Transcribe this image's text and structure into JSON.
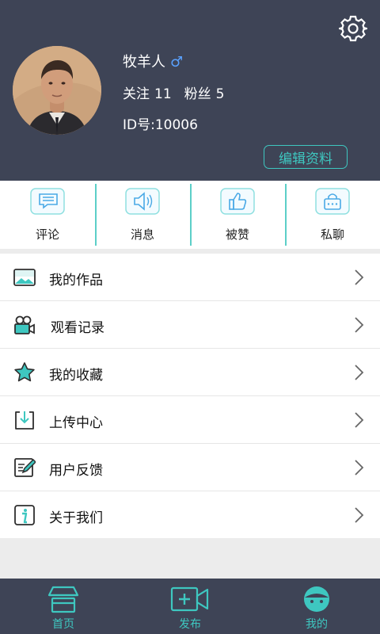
{
  "profile": {
    "name": "牧羊人",
    "gender_symbol": "♂",
    "follow_label": "关注",
    "follow_count": "11",
    "fans_label": "粉丝",
    "fans_count": "5",
    "id_label": "ID号:",
    "id_value": "10006",
    "edit_label": "编辑资料"
  },
  "quick_actions": [
    {
      "label": "评论",
      "icon": "comment-icon"
    },
    {
      "label": "消息",
      "icon": "speaker-icon"
    },
    {
      "label": "被赞",
      "icon": "thumbs-up-icon"
    },
    {
      "label": "私聊",
      "icon": "lock-chat-icon"
    }
  ],
  "menu": [
    {
      "label": "我的作品",
      "icon": "image-icon"
    },
    {
      "label": "观看记录",
      "icon": "video-camera-icon"
    },
    {
      "label": "我的收藏",
      "icon": "star-icon"
    },
    {
      "label": "上传中心",
      "icon": "download-tray-icon"
    },
    {
      "label": "用户反馈",
      "icon": "edit-note-icon"
    },
    {
      "label": "关于我们",
      "icon": "info-icon"
    }
  ],
  "tabbar": [
    {
      "label": "首页",
      "icon": "home-shop-icon"
    },
    {
      "label": "发布",
      "icon": "add-video-icon"
    },
    {
      "label": "我的",
      "icon": "face-icon"
    }
  ],
  "colors": {
    "header_bg": "#3e4456",
    "accent": "#3ec7c0"
  }
}
